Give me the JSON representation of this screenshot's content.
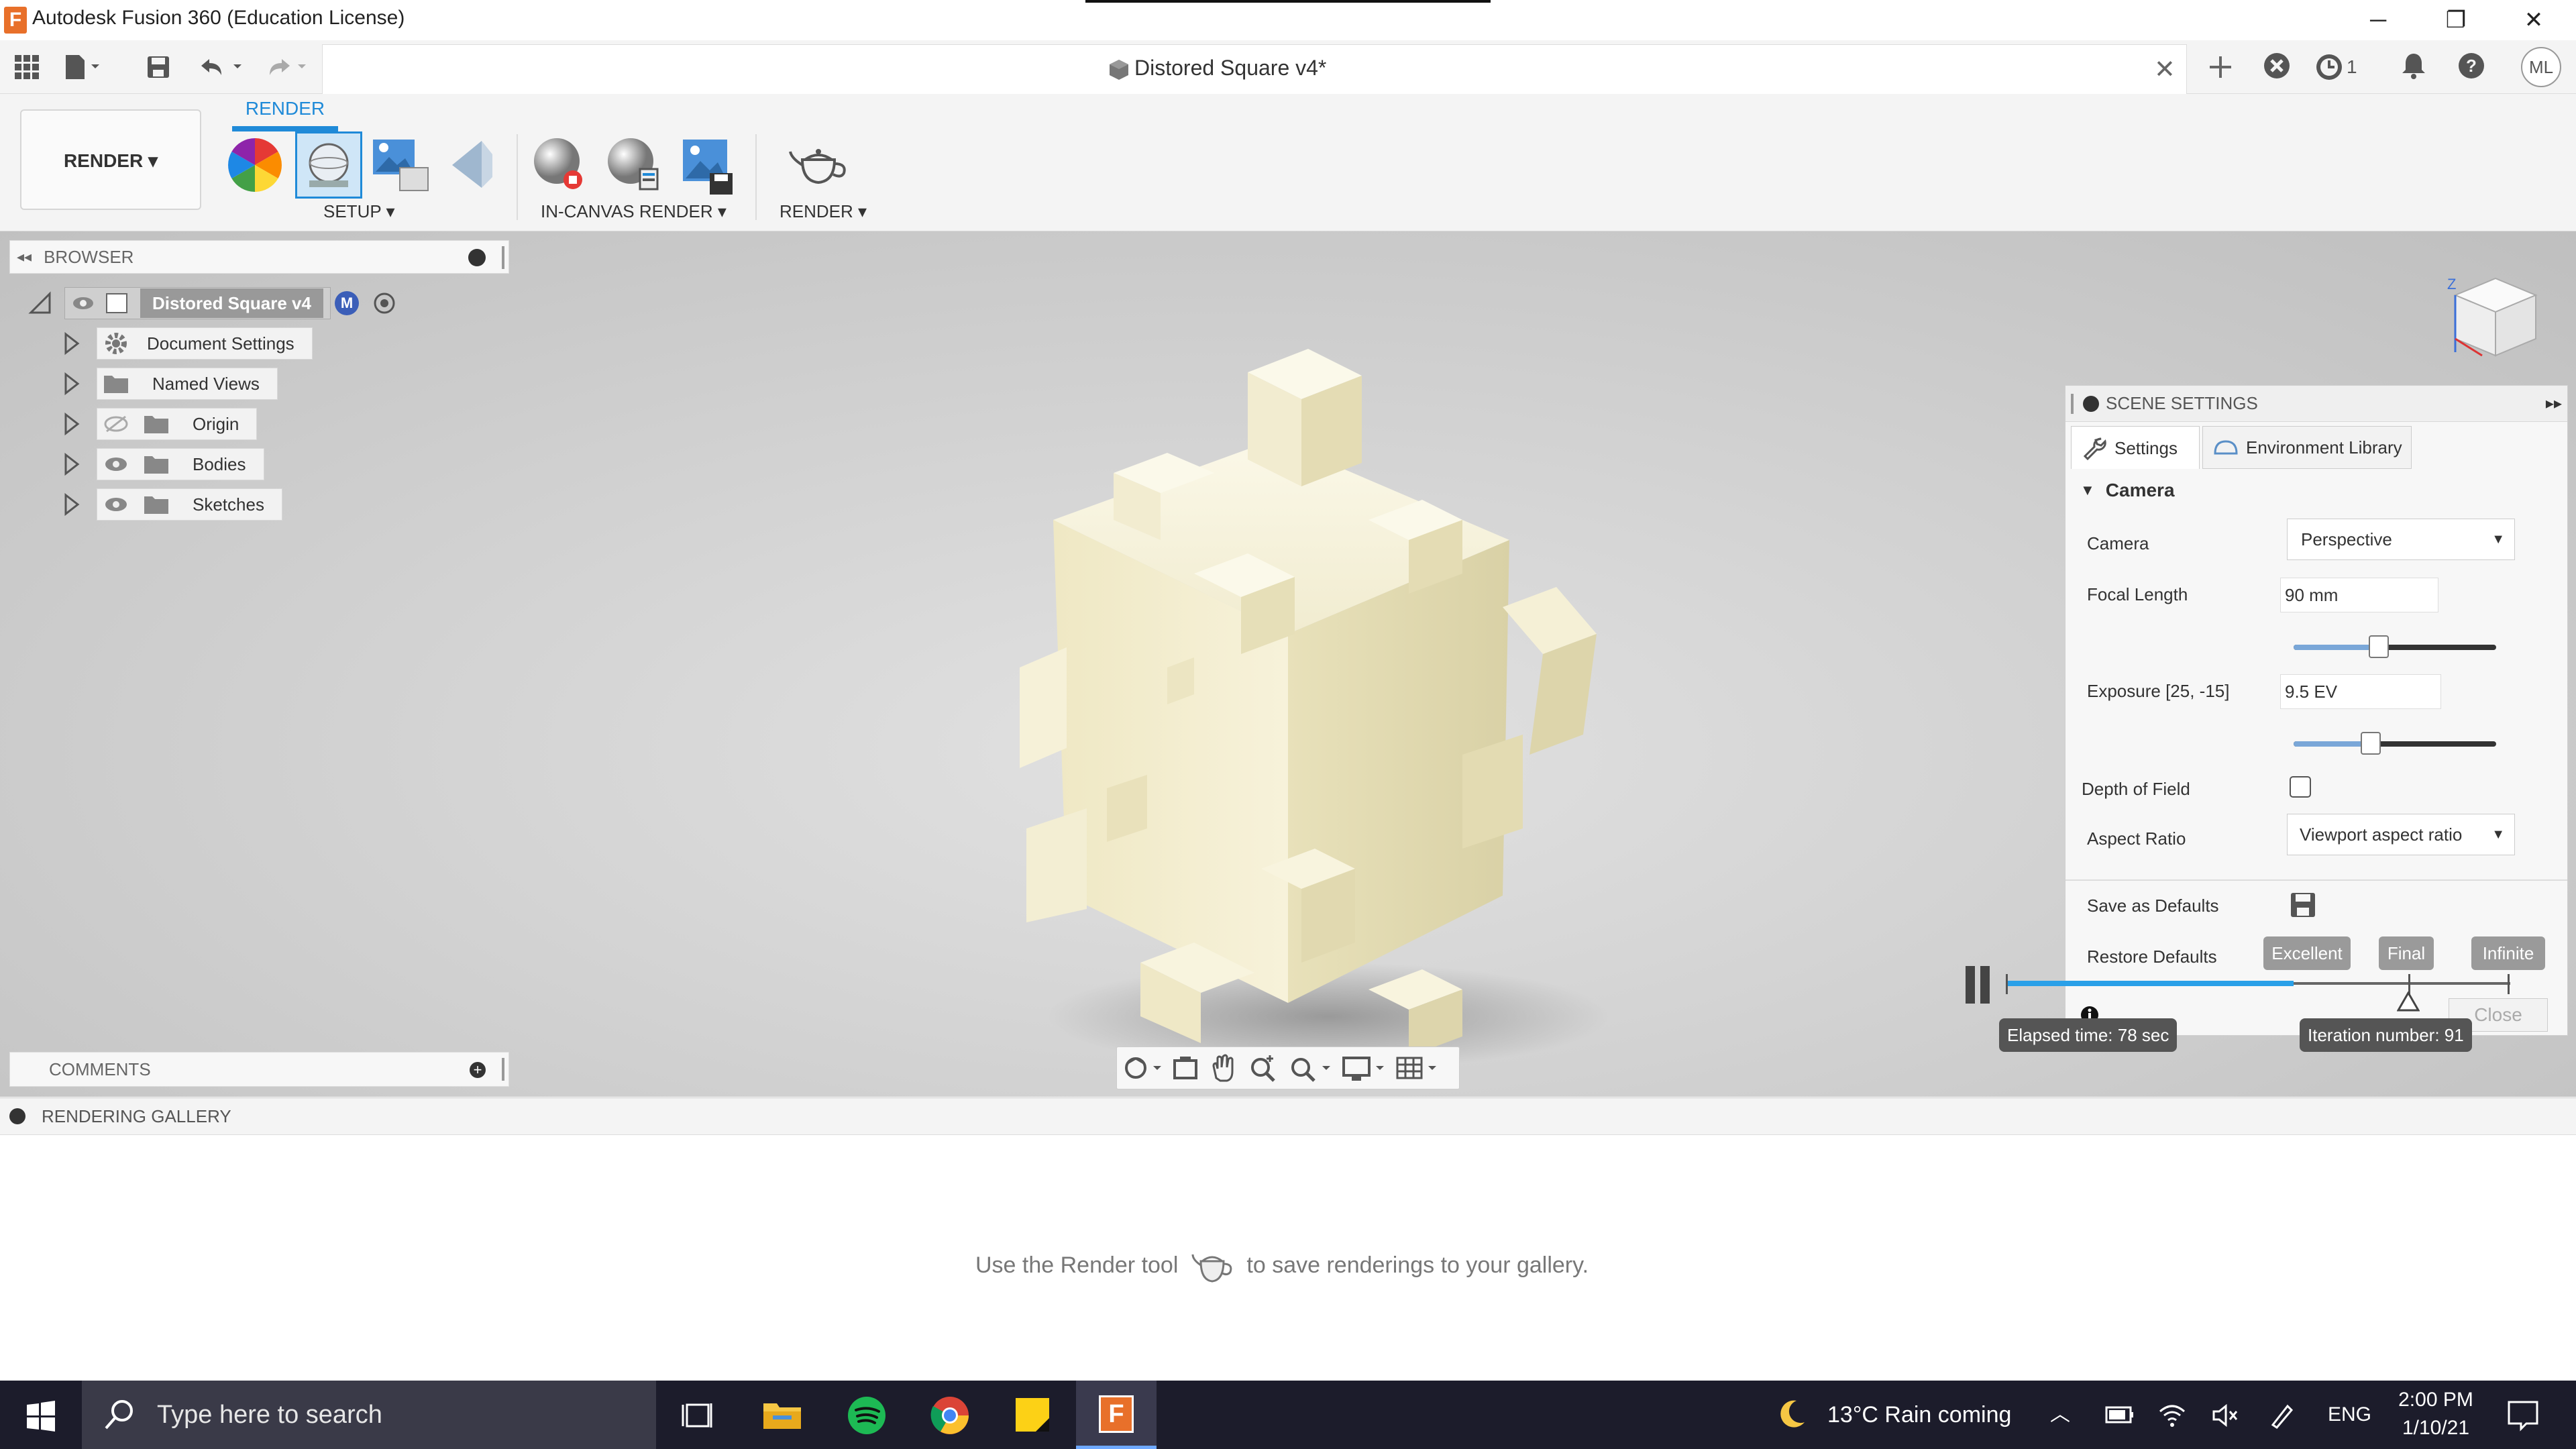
{
  "window": {
    "title": "Autodesk Fusion 360 (Education License)",
    "app_icon_letter": "F",
    "minimize": "─",
    "maximize": "❐",
    "close": "✕"
  },
  "toolbar": {
    "document_tab_title": "Distored Square v4*",
    "tab_close": "✕",
    "jobs_count": "1",
    "user_initials": "ML"
  },
  "ribbon": {
    "workspace_label": "RENDER",
    "active_tab": "RENDER",
    "groups": {
      "setup": "SETUP",
      "in_canvas_render": "IN-CANVAS RENDER",
      "render": "RENDER"
    }
  },
  "browser": {
    "header": "BROWSER",
    "root": "Distored Square v4",
    "root_badge": "M",
    "items": [
      {
        "label": "Document Settings",
        "icon": "gear-icon"
      },
      {
        "label": "Named Views",
        "icon": "folder-icon"
      },
      {
        "label": "Origin",
        "icon": "folder-icon",
        "hidden": true
      },
      {
        "label": "Bodies",
        "icon": "folder-icon"
      },
      {
        "label": "Sketches",
        "icon": "folder-icon"
      }
    ]
  },
  "comments": {
    "header": "COMMENTS"
  },
  "viewcube": {
    "z_label": "Z"
  },
  "scene_settings": {
    "header": "SCENE SETTINGS",
    "tabs": [
      "Settings",
      "Environment Library"
    ],
    "section": "Camera",
    "camera_label": "Camera",
    "camera_value": "Perspective",
    "focal_length_label": "Focal Length",
    "focal_length_value": "90 mm",
    "focal_length_slider": 0.42,
    "exposure_label": "Exposure [25, -15]",
    "exposure_value": "9.5 EV",
    "exposure_slider": 0.38,
    "dof_label": "Depth of Field",
    "dof_checked": false,
    "aspect_label": "Aspect Ratio",
    "aspect_value": "Viewport aspect ratio",
    "save_defaults_label": "Save as Defaults",
    "restore_defaults_label": "Restore Defaults",
    "quality": [
      "Excellent",
      "Final",
      "Infinite"
    ],
    "close_label": "Close"
  },
  "render_progress": {
    "elapsed": "Elapsed time: 78 sec",
    "iteration": "Iteration number: 91",
    "progress": 0.57
  },
  "gallery": {
    "header": "RENDERING GALLERY",
    "message_before": "Use the Render tool",
    "message_after": "to save renderings to your gallery."
  },
  "taskbar": {
    "search_placeholder": "Type here to search",
    "weather": "13°C  Rain coming",
    "language": "ENG",
    "time": "2:00 PM",
    "date": "1/10/21"
  },
  "colors": {
    "accent": "#1f8ad8",
    "fusion_orange": "#e8702a",
    "model": "#f3efd4",
    "taskbar": "#1c1c2b"
  }
}
